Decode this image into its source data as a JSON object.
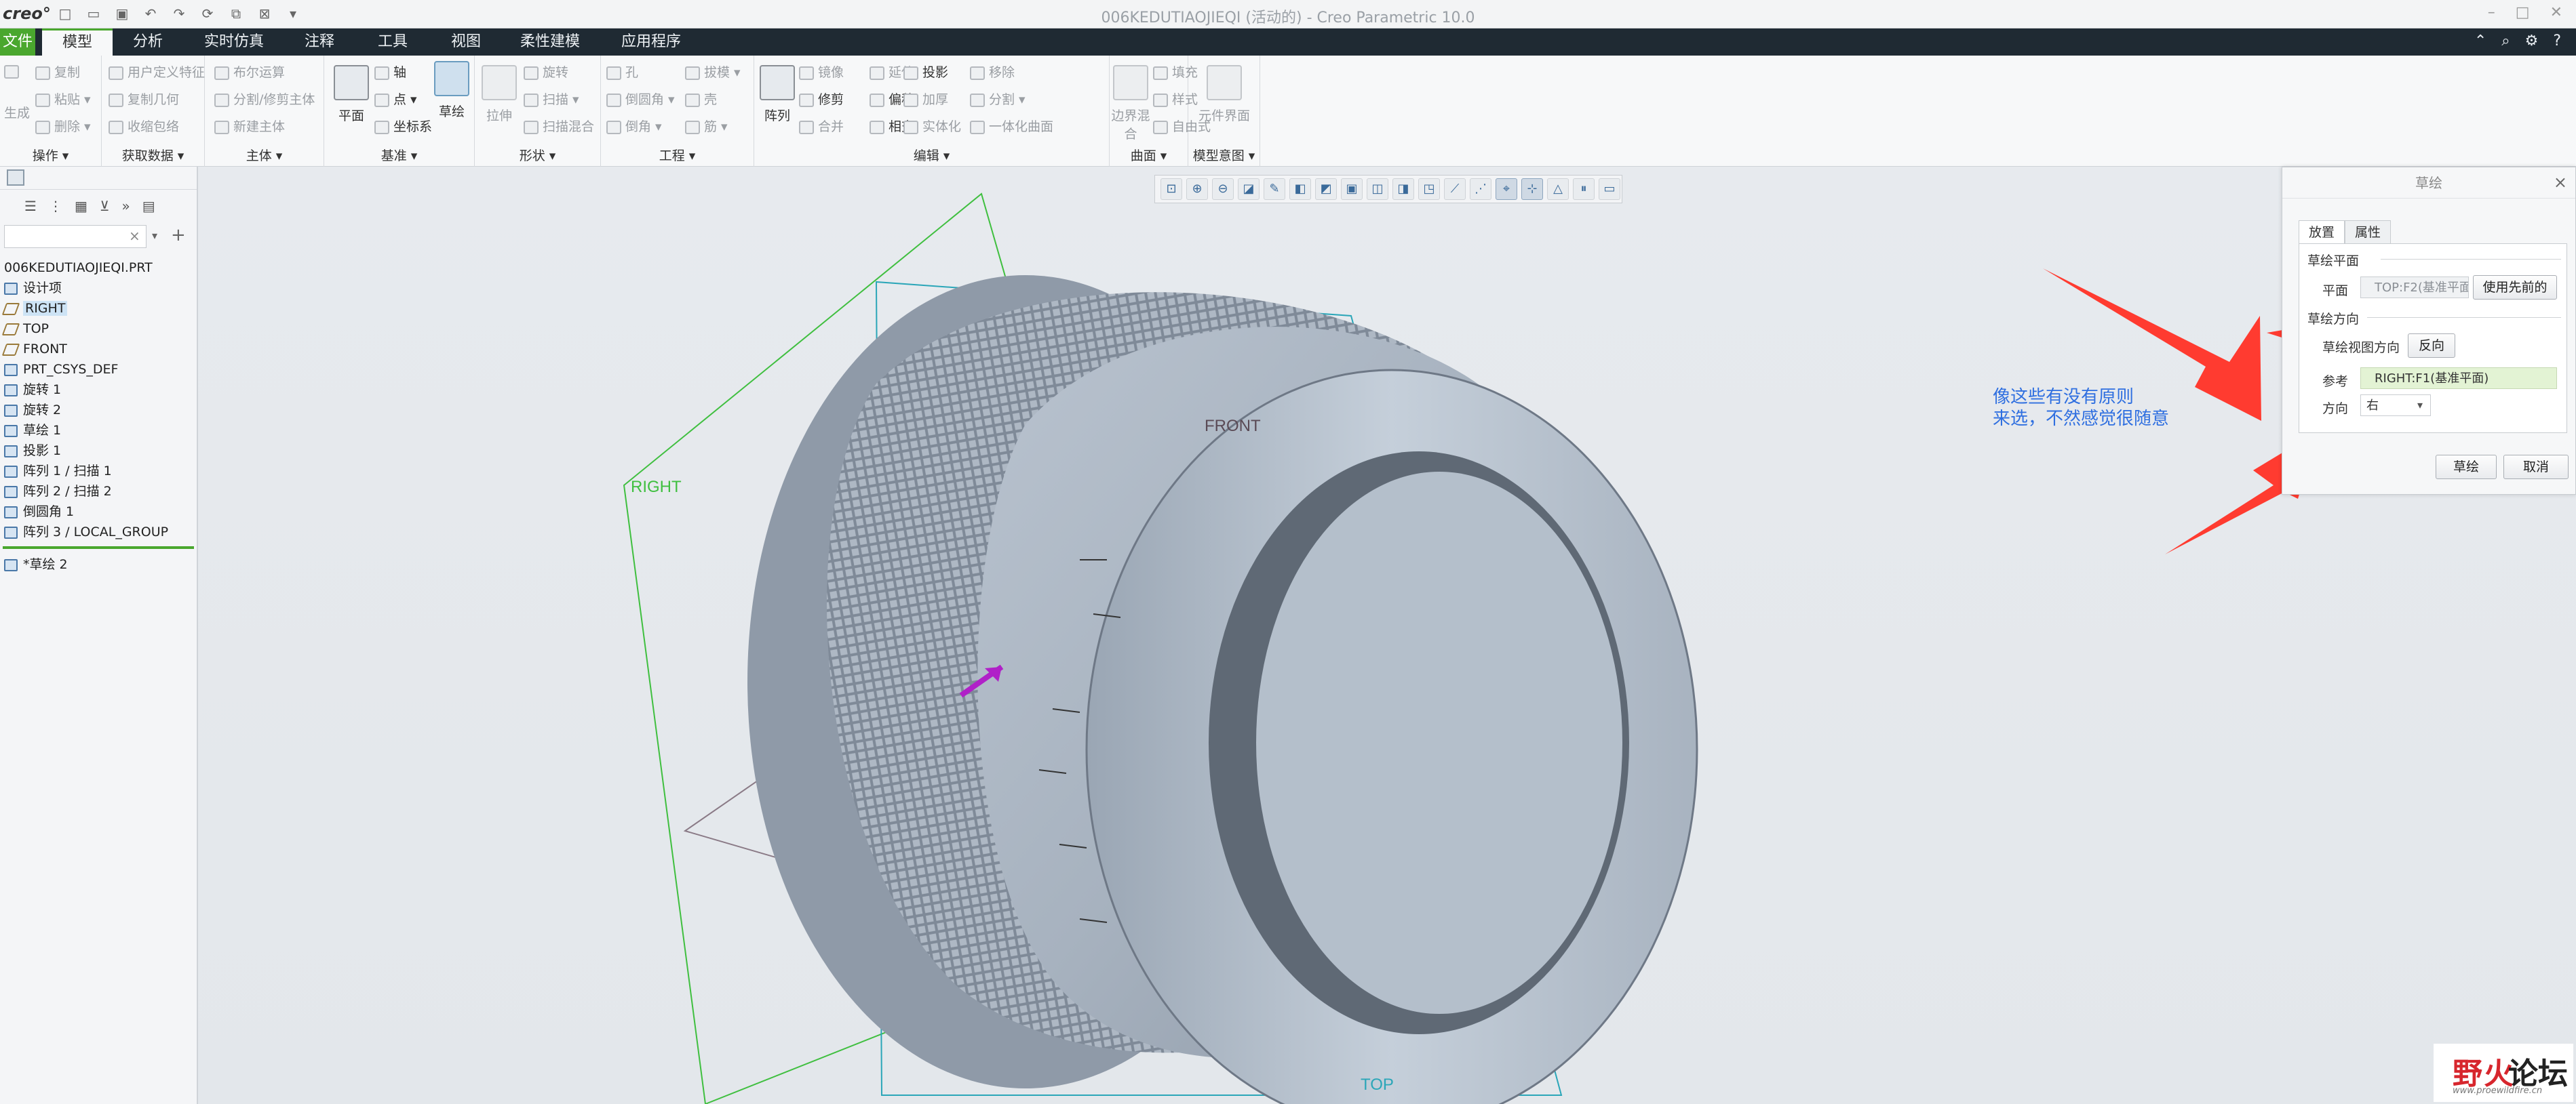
{
  "window": {
    "logo": "creo°",
    "title": "006KEDUTIAOJIEQI (活动的) - Creo Parametric 10.0"
  },
  "menu": {
    "file": "文件",
    "tabs": [
      "模型",
      "分析",
      "实时仿真",
      "注释",
      "工具",
      "视图",
      "柔性建模",
      "应用程序"
    ],
    "active_tab": "模型"
  },
  "ribbon": {
    "groups": {
      "operations": {
        "label": "操作 ▾",
        "items": [
          "复制",
          "粘贴 ▾",
          "删除 ▾"
        ],
        "regen": "生成"
      },
      "get_data": {
        "label": "获取数据 ▾",
        "items": [
          "用户定义特征",
          "复制几何",
          "收缩包络"
        ]
      },
      "body": {
        "label": "主体 ▾",
        "items": [
          "布尔运算",
          "分割/修剪主体",
          "新建主体"
        ]
      },
      "datum": {
        "label": "基准 ▾",
        "plane": "平面",
        "items": [
          "轴",
          "点 ▾",
          "坐标系"
        ],
        "sketch": "草绘"
      },
      "shapes": {
        "label": "形状 ▾",
        "extrude": "拉伸",
        "items": [
          "旋转",
          "扫描 ▾",
          "扫描混合"
        ]
      },
      "engineering": {
        "label": "工程 ▾",
        "items": [
          "孔",
          "倒圆角 ▾",
          "倒角 ▾",
          "拔模 ▾",
          "壳",
          "筋 ▾"
        ]
      },
      "editing": {
        "label": "编辑 ▾",
        "pattern": "阵列",
        "items": [
          "镜像",
          "修剪",
          "合并",
          "延伸",
          "偏移",
          "相交",
          "投影",
          "加厚",
          "实体化",
          "移除",
          "分割 ▾",
          "一体化曲面"
        ]
      },
      "surfaces": {
        "label": "曲面 ▾",
        "boundary": "边界混合",
        "items": [
          "填充",
          "样式",
          "自由式"
        ]
      },
      "model_intent": {
        "label": "模型意图 ▾",
        "component": "元件界面"
      }
    }
  },
  "model_tree": {
    "root": "006KEDUTIAOJIEQI.PRT",
    "items": [
      {
        "label": "设计项",
        "icon": "design-items-icon"
      },
      {
        "label": "RIGHT",
        "icon": "datum-plane-icon",
        "highlighted": true
      },
      {
        "label": "TOP",
        "icon": "datum-plane-icon"
      },
      {
        "label": "FRONT",
        "icon": "datum-plane-icon"
      },
      {
        "label": "PRT_CSYS_DEF",
        "icon": "csys-icon"
      },
      {
        "label": "旋转 1",
        "icon": "revolve-icon"
      },
      {
        "label": "旋转 2",
        "icon": "revolve-icon"
      },
      {
        "label": "草绘 1",
        "icon": "sketch-icon"
      },
      {
        "label": "投影 1",
        "icon": "projection-icon"
      },
      {
        "label": "阵列 1 / 扫描 1",
        "icon": "pattern-icon"
      },
      {
        "label": "阵列 2 / 扫描 2",
        "icon": "pattern-icon"
      },
      {
        "label": "倒圆角 1",
        "icon": "round-icon"
      },
      {
        "label": "阵列 3 / LOCAL_GROUP",
        "icon": "pattern-icon"
      }
    ],
    "inserted": "*草绘 2"
  },
  "viewport": {
    "plane_labels": {
      "right": "RIGHT",
      "front": "FRONT",
      "top": "TOP"
    }
  },
  "sketch_dialog": {
    "title": "草绘",
    "tabs": [
      "放置",
      "属性"
    ],
    "active_tab": "放置",
    "sketch_plane_section": "草绘平面",
    "plane_label": "平面",
    "plane_value": "TOP:F2(基准平面)",
    "use_previous": "使用先前的",
    "orientation_section": "草绘方向",
    "view_direction_label": "草绘视图方向",
    "flip_button": "反向",
    "reference_label": "参考",
    "reference_value": "RIGHT:F1(基准平面)",
    "orientation_label": "方向",
    "orientation_value": "右",
    "ok": "草绘",
    "cancel": "取消"
  },
  "annotation": {
    "line1": "像这些有没有原则",
    "line2": "来选，不然感觉很随意"
  },
  "watermark": {
    "text1": "野火",
    "text2": "论坛",
    "url": "www.proewildfire.cn"
  },
  "colors": {
    "file_tab": "#4aa72e",
    "menubar": "#1f2a33",
    "annotation_text": "#2f6fe0",
    "arrow": "#ff3b30",
    "model": "#a3aebb",
    "datum_right": "#3fbf3f",
    "datum_top": "#2aa6b8"
  }
}
